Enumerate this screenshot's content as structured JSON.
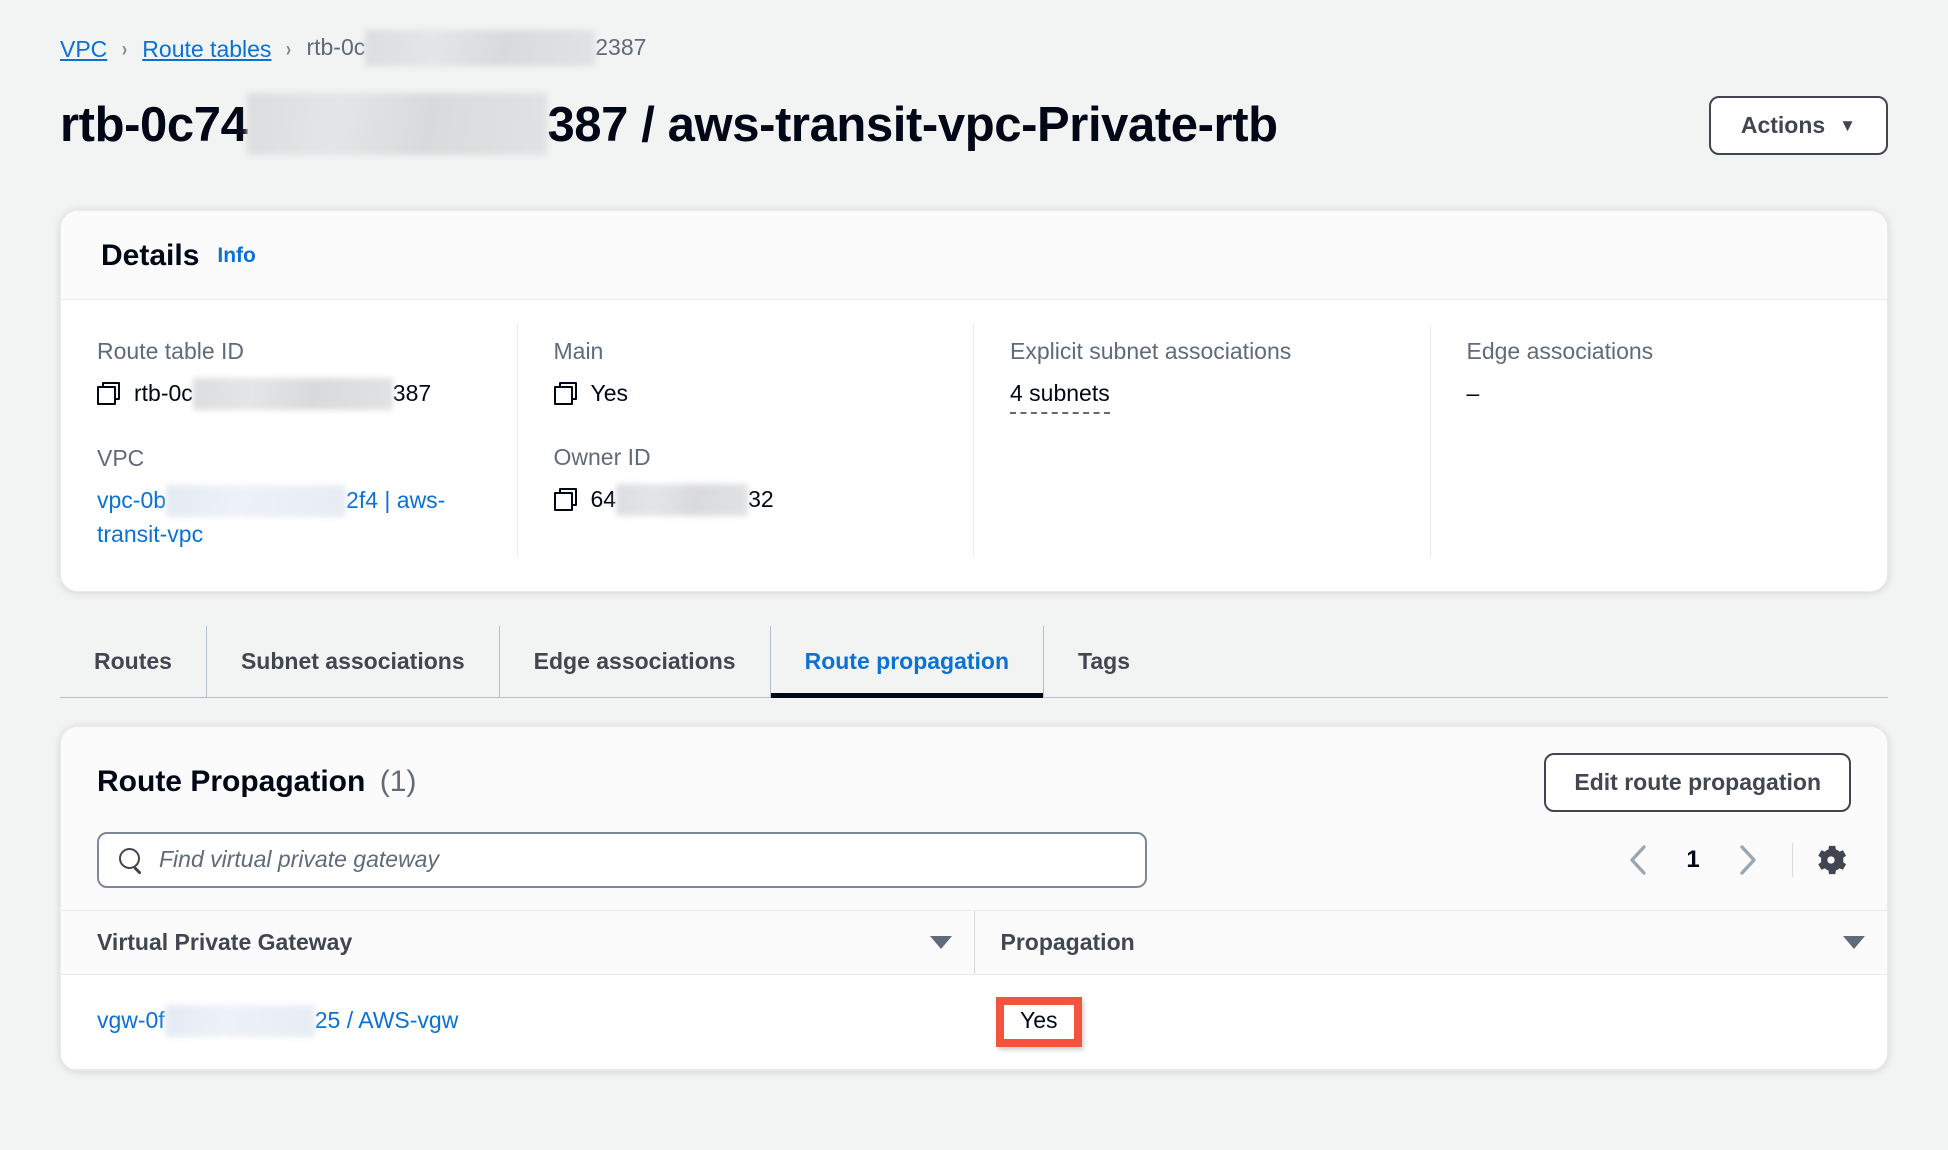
{
  "breadcrumb": {
    "items": [
      {
        "label": "VPC",
        "type": "link"
      },
      {
        "label": "Route tables",
        "type": "link"
      },
      {
        "label_prefix": "rtb-0c",
        "label_suffix": "2387",
        "type": "current"
      }
    ],
    "separator": "›"
  },
  "header": {
    "title_prefix": "rtb-0c74",
    "title_suffix": "387 / aws-transit-vpc-Private-rtb",
    "actions_label": "Actions",
    "actions_caret": "▼"
  },
  "details": {
    "heading": "Details",
    "info_label": "Info",
    "fields": {
      "route_table_id": {
        "label": "Route table ID",
        "value_prefix": "rtb-0c",
        "value_suffix": "387",
        "copy_icon": "copy-icon"
      },
      "main": {
        "label": "Main",
        "value": "Yes",
        "copy_icon": "copy-icon"
      },
      "explicit_subnet_associations": {
        "label": "Explicit subnet associations",
        "value": "4 subnets"
      },
      "edge_associations": {
        "label": "Edge associations",
        "value": "–"
      },
      "vpc": {
        "label": "VPC",
        "value_prefix": "vpc-0b",
        "value_suffix": "2f4 | aws-transit-vpc"
      },
      "owner_id": {
        "label": "Owner ID",
        "value_prefix": "64",
        "value_suffix": "32",
        "copy_icon": "copy-icon"
      }
    }
  },
  "tabs": [
    {
      "label": "Routes",
      "active": false
    },
    {
      "label": "Subnet associations",
      "active": false
    },
    {
      "label": "Edge associations",
      "active": false
    },
    {
      "label": "Route propagation",
      "active": true
    },
    {
      "label": "Tags",
      "active": false
    }
  ],
  "propagation_panel": {
    "title": "Route Propagation",
    "count": "(1)",
    "edit_label": "Edit route propagation",
    "search": {
      "placeholder": "Find virtual private gateway",
      "value": "",
      "icon": "search-icon"
    },
    "pagination": {
      "prev_icon": "chevron-left-icon",
      "page": "1",
      "next_icon": "chevron-right-icon",
      "settings_icon": "gear-icon"
    },
    "columns": [
      {
        "label": "Virtual Private Gateway",
        "sort_icon": "sort-descending-icon"
      },
      {
        "label": "Propagation",
        "sort_icon": "sort-descending-icon"
      }
    ],
    "rows": [
      {
        "gateway_prefix": "vgw-0f",
        "gateway_suffix": "25 / AWS-vgw",
        "propagation": "Yes",
        "propagation_highlighted": true
      }
    ]
  },
  "colors": {
    "accent_blue": "#0972d3",
    "text_dark": "#000716",
    "text_muted": "#5f6b7a",
    "background": "#f2f3f3",
    "highlight_red": "#f4543c"
  }
}
